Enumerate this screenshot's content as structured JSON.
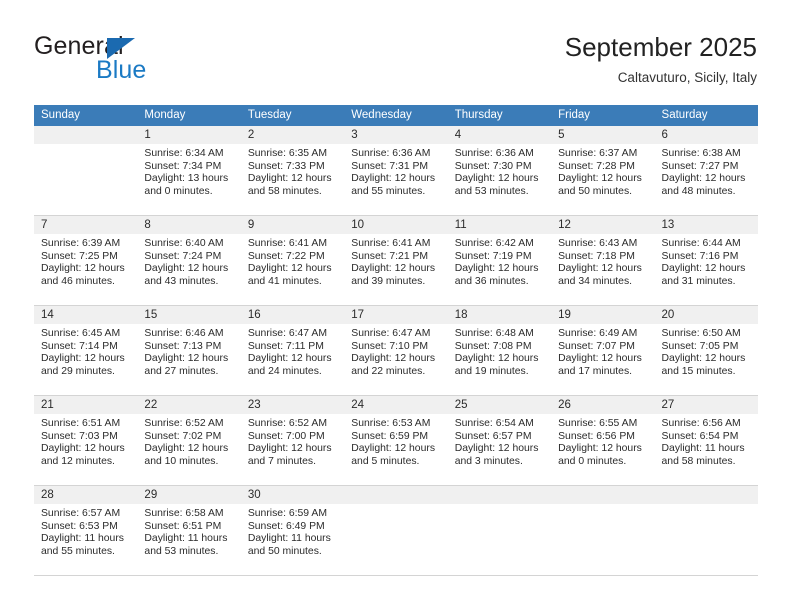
{
  "brand": {
    "name_top": "General",
    "name_bottom": "Blue",
    "triangle_icon": "blue-triangle-icon",
    "color_dark": "#231f20",
    "color_blue": "#1b7ac4"
  },
  "header": {
    "title": "September 2025",
    "subtitle": "Caltavuturo, Sicily, Italy"
  },
  "theme": {
    "header_row_bg": "#3b7cb8",
    "day_band_bg": "#f0f0f0",
    "grid_line": "#d4d4d4",
    "text": "#2b2b2b"
  },
  "weekdays": [
    "Sunday",
    "Monday",
    "Tuesday",
    "Wednesday",
    "Thursday",
    "Friday",
    "Saturday"
  ],
  "weeks": [
    [
      {
        "day": "",
        "sunrise": "",
        "sunset": "",
        "daylight_1": "",
        "daylight_2": ""
      },
      {
        "day": "1",
        "sunrise": "Sunrise: 6:34 AM",
        "sunset": "Sunset: 7:34 PM",
        "daylight_1": "Daylight: 13 hours",
        "daylight_2": "and 0 minutes."
      },
      {
        "day": "2",
        "sunrise": "Sunrise: 6:35 AM",
        "sunset": "Sunset: 7:33 PM",
        "daylight_1": "Daylight: 12 hours",
        "daylight_2": "and 58 minutes."
      },
      {
        "day": "3",
        "sunrise": "Sunrise: 6:36 AM",
        "sunset": "Sunset: 7:31 PM",
        "daylight_1": "Daylight: 12 hours",
        "daylight_2": "and 55 minutes."
      },
      {
        "day": "4",
        "sunrise": "Sunrise: 6:36 AM",
        "sunset": "Sunset: 7:30 PM",
        "daylight_1": "Daylight: 12 hours",
        "daylight_2": "and 53 minutes."
      },
      {
        "day": "5",
        "sunrise": "Sunrise: 6:37 AM",
        "sunset": "Sunset: 7:28 PM",
        "daylight_1": "Daylight: 12 hours",
        "daylight_2": "and 50 minutes."
      },
      {
        "day": "6",
        "sunrise": "Sunrise: 6:38 AM",
        "sunset": "Sunset: 7:27 PM",
        "daylight_1": "Daylight: 12 hours",
        "daylight_2": "and 48 minutes."
      }
    ],
    [
      {
        "day": "7",
        "sunrise": "Sunrise: 6:39 AM",
        "sunset": "Sunset: 7:25 PM",
        "daylight_1": "Daylight: 12 hours",
        "daylight_2": "and 46 minutes."
      },
      {
        "day": "8",
        "sunrise": "Sunrise: 6:40 AM",
        "sunset": "Sunset: 7:24 PM",
        "daylight_1": "Daylight: 12 hours",
        "daylight_2": "and 43 minutes."
      },
      {
        "day": "9",
        "sunrise": "Sunrise: 6:41 AM",
        "sunset": "Sunset: 7:22 PM",
        "daylight_1": "Daylight: 12 hours",
        "daylight_2": "and 41 minutes."
      },
      {
        "day": "10",
        "sunrise": "Sunrise: 6:41 AM",
        "sunset": "Sunset: 7:21 PM",
        "daylight_1": "Daylight: 12 hours",
        "daylight_2": "and 39 minutes."
      },
      {
        "day": "11",
        "sunrise": "Sunrise: 6:42 AM",
        "sunset": "Sunset: 7:19 PM",
        "daylight_1": "Daylight: 12 hours",
        "daylight_2": "and 36 minutes."
      },
      {
        "day": "12",
        "sunrise": "Sunrise: 6:43 AM",
        "sunset": "Sunset: 7:18 PM",
        "daylight_1": "Daylight: 12 hours",
        "daylight_2": "and 34 minutes."
      },
      {
        "day": "13",
        "sunrise": "Sunrise: 6:44 AM",
        "sunset": "Sunset: 7:16 PM",
        "daylight_1": "Daylight: 12 hours",
        "daylight_2": "and 31 minutes."
      }
    ],
    [
      {
        "day": "14",
        "sunrise": "Sunrise: 6:45 AM",
        "sunset": "Sunset: 7:14 PM",
        "daylight_1": "Daylight: 12 hours",
        "daylight_2": "and 29 minutes."
      },
      {
        "day": "15",
        "sunrise": "Sunrise: 6:46 AM",
        "sunset": "Sunset: 7:13 PM",
        "daylight_1": "Daylight: 12 hours",
        "daylight_2": "and 27 minutes."
      },
      {
        "day": "16",
        "sunrise": "Sunrise: 6:47 AM",
        "sunset": "Sunset: 7:11 PM",
        "daylight_1": "Daylight: 12 hours",
        "daylight_2": "and 24 minutes."
      },
      {
        "day": "17",
        "sunrise": "Sunrise: 6:47 AM",
        "sunset": "Sunset: 7:10 PM",
        "daylight_1": "Daylight: 12 hours",
        "daylight_2": "and 22 minutes."
      },
      {
        "day": "18",
        "sunrise": "Sunrise: 6:48 AM",
        "sunset": "Sunset: 7:08 PM",
        "daylight_1": "Daylight: 12 hours",
        "daylight_2": "and 19 minutes."
      },
      {
        "day": "19",
        "sunrise": "Sunrise: 6:49 AM",
        "sunset": "Sunset: 7:07 PM",
        "daylight_1": "Daylight: 12 hours",
        "daylight_2": "and 17 minutes."
      },
      {
        "day": "20",
        "sunrise": "Sunrise: 6:50 AM",
        "sunset": "Sunset: 7:05 PM",
        "daylight_1": "Daylight: 12 hours",
        "daylight_2": "and 15 minutes."
      }
    ],
    [
      {
        "day": "21",
        "sunrise": "Sunrise: 6:51 AM",
        "sunset": "Sunset: 7:03 PM",
        "daylight_1": "Daylight: 12 hours",
        "daylight_2": "and 12 minutes."
      },
      {
        "day": "22",
        "sunrise": "Sunrise: 6:52 AM",
        "sunset": "Sunset: 7:02 PM",
        "daylight_1": "Daylight: 12 hours",
        "daylight_2": "and 10 minutes."
      },
      {
        "day": "23",
        "sunrise": "Sunrise: 6:52 AM",
        "sunset": "Sunset: 7:00 PM",
        "daylight_1": "Daylight: 12 hours",
        "daylight_2": "and 7 minutes."
      },
      {
        "day": "24",
        "sunrise": "Sunrise: 6:53 AM",
        "sunset": "Sunset: 6:59 PM",
        "daylight_1": "Daylight: 12 hours",
        "daylight_2": "and 5 minutes."
      },
      {
        "day": "25",
        "sunrise": "Sunrise: 6:54 AM",
        "sunset": "Sunset: 6:57 PM",
        "daylight_1": "Daylight: 12 hours",
        "daylight_2": "and 3 minutes."
      },
      {
        "day": "26",
        "sunrise": "Sunrise: 6:55 AM",
        "sunset": "Sunset: 6:56 PM",
        "daylight_1": "Daylight: 12 hours",
        "daylight_2": "and 0 minutes."
      },
      {
        "day": "27",
        "sunrise": "Sunrise: 6:56 AM",
        "sunset": "Sunset: 6:54 PM",
        "daylight_1": "Daylight: 11 hours",
        "daylight_2": "and 58 minutes."
      }
    ],
    [
      {
        "day": "28",
        "sunrise": "Sunrise: 6:57 AM",
        "sunset": "Sunset: 6:53 PM",
        "daylight_1": "Daylight: 11 hours",
        "daylight_2": "and 55 minutes."
      },
      {
        "day": "29",
        "sunrise": "Sunrise: 6:58 AM",
        "sunset": "Sunset: 6:51 PM",
        "daylight_1": "Daylight: 11 hours",
        "daylight_2": "and 53 minutes."
      },
      {
        "day": "30",
        "sunrise": "Sunrise: 6:59 AM",
        "sunset": "Sunset: 6:49 PM",
        "daylight_1": "Daylight: 11 hours",
        "daylight_2": "and 50 minutes."
      },
      {
        "day": "",
        "sunrise": "",
        "sunset": "",
        "daylight_1": "",
        "daylight_2": ""
      },
      {
        "day": "",
        "sunrise": "",
        "sunset": "",
        "daylight_1": "",
        "daylight_2": ""
      },
      {
        "day": "",
        "sunrise": "",
        "sunset": "",
        "daylight_1": "",
        "daylight_2": ""
      },
      {
        "day": "",
        "sunrise": "",
        "sunset": "",
        "daylight_1": "",
        "daylight_2": ""
      }
    ]
  ]
}
